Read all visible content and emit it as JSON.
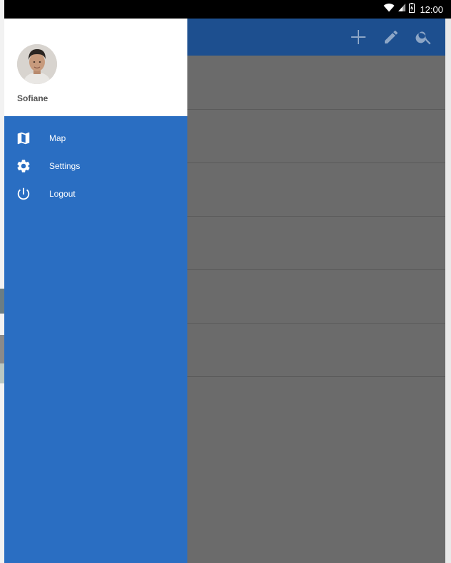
{
  "status_bar": {
    "time": "12:00"
  },
  "app_bar": {
    "actions": [
      {
        "icon": "plus-icon"
      },
      {
        "icon": "pencil-icon"
      },
      {
        "icon": "search-icon"
      }
    ]
  },
  "drawer": {
    "user": {
      "name": "Sofiane"
    },
    "menu": [
      {
        "label": "Map",
        "icon": "map-icon"
      },
      {
        "label": "Settings",
        "icon": "gear-icon"
      },
      {
        "label": "Logout",
        "icon": "power-icon"
      }
    ]
  },
  "colors": {
    "drawer_background": "#2a6ec2",
    "app_bar": "#1d4f8f",
    "scrim_content": "#6b6b6b",
    "status_bar": "#000000"
  }
}
